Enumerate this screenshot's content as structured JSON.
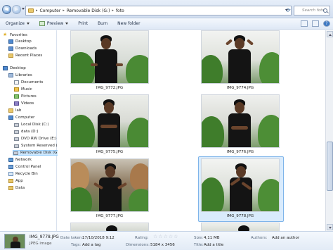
{
  "address": {
    "crumbs": [
      "Computer",
      "Removable Disk (G:)",
      "foto"
    ],
    "search_placeholder": "Search foto"
  },
  "toolbar": {
    "organize": "Organize",
    "preview": "Preview",
    "print": "Print",
    "burn": "Burn",
    "new_folder": "New folder"
  },
  "nav": {
    "favorites": "Favorites",
    "desktop1": "Desktop",
    "downloads": "Downloads",
    "recent": "Recent Places",
    "desktop2": "Desktop",
    "libraries": "Libraries",
    "documents": "Documents",
    "music": "Music",
    "pictures": "Pictures",
    "videos": "Videos",
    "lab": "lab",
    "computer": "Computer",
    "local_c": "Local Disk (C:)",
    "data_d": "data (D:)",
    "dvd_e": "DVD RW Drive (E:)",
    "sysres_f": "System Reserved (F:)",
    "removable_g": "Removable Disk (G:)",
    "network": "Network",
    "control_panel": "Control Panel",
    "recycle_bin": "Recycle Bin",
    "app": "App",
    "data": "Data"
  },
  "files": [
    {
      "name": "IMG_9772.JPG"
    },
    {
      "name": "IMG_9774.JPG"
    },
    {
      "name": "IMG_9775.JPG"
    },
    {
      "name": "IMG_9776.JPG"
    },
    {
      "name": "IMG_9777.JPG"
    },
    {
      "name": "IMG_9778.JPG"
    }
  ],
  "details": {
    "name": "IMG_9778.JPG",
    "type": "JPEG image",
    "date_taken_label": "Date taken:",
    "date_taken": "17/10/2018 9:12",
    "tags_label": "Tags:",
    "tags": "Add a tag",
    "rating_label": "Rating:",
    "dimensions_label": "Dimensions:",
    "dimensions": "5184 x 3456",
    "size_label": "Size:",
    "size": "4,11 MB",
    "title_label": "Title:",
    "title": "Add a title",
    "authors_label": "Authors:",
    "authors": "Add an author"
  },
  "colors": {
    "selection": "#cce8ff",
    "toolbar_bg": "#dfe9f6"
  }
}
